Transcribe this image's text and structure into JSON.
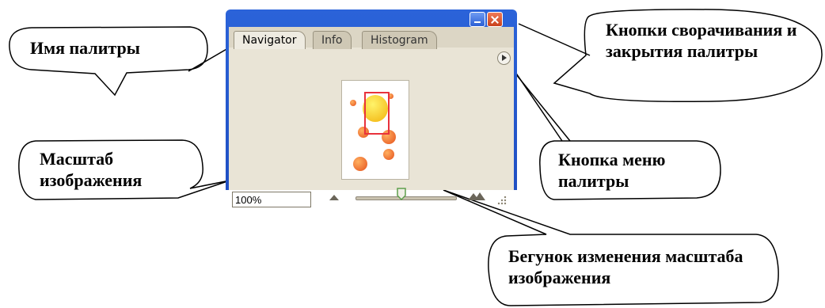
{
  "palette": {
    "tabs": [
      "Navigator",
      "Info",
      "Histogram"
    ],
    "zoom_value": "100%",
    "slider_fraction": 0.45
  },
  "annotations": {
    "palette_name": "Имя палитры",
    "title_buttons": "Кнопки сворачивания и закрытия палитры",
    "menu_button": "Кнопка меню палитры",
    "zoom_level": "Масштаб изображения",
    "zoom_slider": "Бегунок изменения масштаба изображения"
  },
  "icons": [
    "minimize-icon",
    "close-icon",
    "palette-menu-icon",
    "zoom-out-mountain-icon",
    "zoom-in-mountain-icon",
    "resize-grip-icon"
  ]
}
